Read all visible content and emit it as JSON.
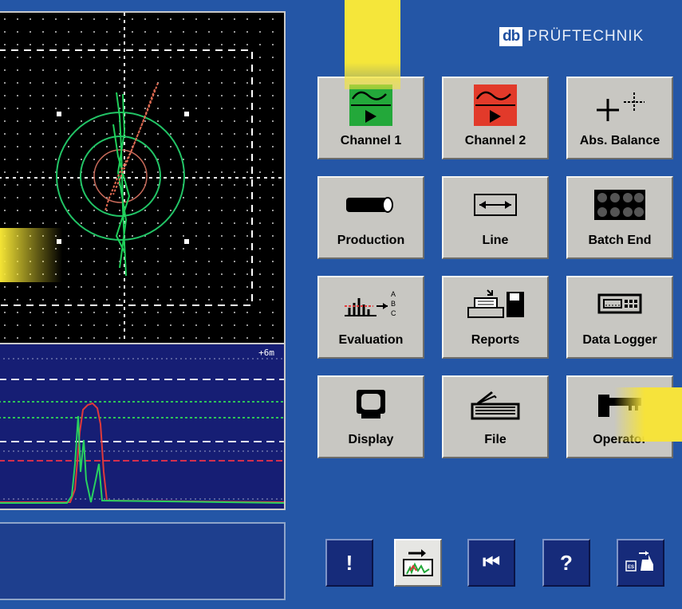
{
  "brand": {
    "logo": "db",
    "name": "PRÜFTECHNIK"
  },
  "trace": {
    "marker": "+6m"
  },
  "buttons": [
    {
      "label": "Channel 1",
      "icon": "channel-1-icon"
    },
    {
      "label": "Channel 2",
      "icon": "channel-2-icon"
    },
    {
      "label": "Abs. Balance",
      "icon": "abs-balance-icon"
    },
    {
      "label": "Production",
      "icon": "production-icon"
    },
    {
      "label": "Line",
      "icon": "line-icon"
    },
    {
      "label": "Batch End",
      "icon": "batch-end-icon"
    },
    {
      "label": "Evaluation",
      "icon": "evaluation-icon"
    },
    {
      "label": "Reports",
      "icon": "reports-icon"
    },
    {
      "label": "Data Logger",
      "icon": "data-logger-icon"
    },
    {
      "label": "Display",
      "icon": "display-icon"
    },
    {
      "label": "File",
      "icon": "file-icon"
    },
    {
      "label": "Operator",
      "icon": "operator-icon"
    }
  ],
  "bottom_bar": {
    "alert": "!",
    "back": "⏮",
    "help": "?",
    "esc_icon": "esc-icon"
  },
  "colors": {
    "background": "#2456a6",
    "button": "#c8c7c2",
    "highlight": "#f5e63a",
    "channel1": "#23a83a",
    "channel2": "#e23a2a"
  }
}
